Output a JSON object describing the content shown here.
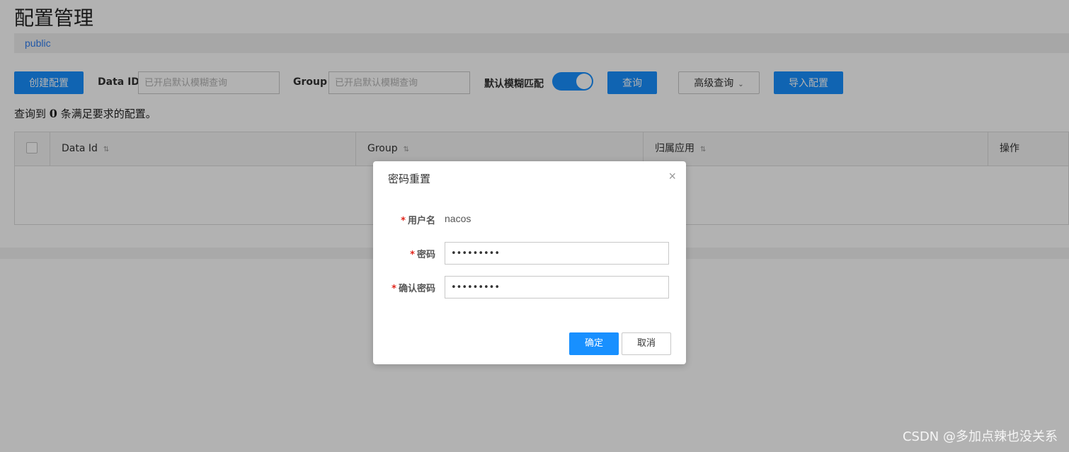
{
  "page": {
    "title": "配置管理",
    "namespace": "public"
  },
  "toolbar": {
    "create_label": "创建配置",
    "data_id_label": "Data ID",
    "data_id_placeholder": "已开启默认模糊查询",
    "group_label": "Group",
    "group_placeholder": "已开启默认模糊查询",
    "fuzzy_match_label": "默认模糊匹配",
    "fuzzy_match_enabled": true,
    "search_label": "查询",
    "advanced_label": "高级查询",
    "import_label": "导入配置"
  },
  "results": {
    "prefix": "查询到",
    "count": "0",
    "suffix": "条满足要求的配置。"
  },
  "table": {
    "columns": [
      {
        "label": "Data Id"
      },
      {
        "label": "Group"
      },
      {
        "label": "归属应用"
      },
      {
        "label": "操作"
      }
    ],
    "rows": []
  },
  "dialog": {
    "title": "密码重置",
    "username_label": "用户名",
    "username_value": "nacos",
    "password_label": "密码",
    "password_value": "123456789",
    "confirm_label": "确认密码",
    "confirm_value": "123456789",
    "ok_label": "确定",
    "cancel_label": "取消"
  },
  "watermark": "CSDN @多加点辣也没关系",
  "colors": {
    "primary": "#1890ff",
    "required": "#e1251b",
    "link": "#2e7df0"
  },
  "icons": {
    "close": "close-icon",
    "sort": "sort-icon",
    "dropdown": "chevron-down-icon"
  }
}
